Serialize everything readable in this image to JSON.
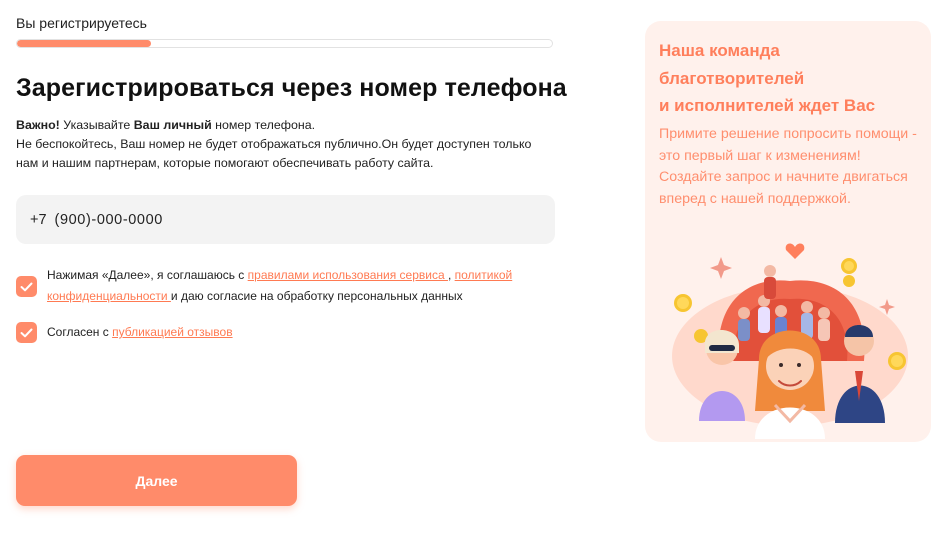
{
  "progress": {
    "label": "Вы регистрируетесь",
    "value_fraction": 0.25
  },
  "title": "Зарегистрироваться через номер телефона",
  "notice": {
    "important": "Важно!",
    "text1": " Указывайте ",
    "bold2": "Ваш личный",
    "text2": " номер телефона.",
    "line2": "Не беспокойтесь, Ваш номер не будет отображаться публично.Он будет доступен только нам и нашим партнерам, которые помогают обеспечивать работу сайта."
  },
  "phone": {
    "code": "+7",
    "value": "",
    "placeholder": "(900)-000-0000"
  },
  "consent1": {
    "checked": true,
    "prefix": "Нажимая «Далее», я соглашаюсь с ",
    "link1": "правилами использования сервиса ",
    "sep": ", ",
    "link2": "политикой конфиденциальности ",
    "suffix": " и даю согласие на обработку персональных данных"
  },
  "consent2": {
    "checked": true,
    "prefix": "Согласен с ",
    "link": "публикацией отзывов"
  },
  "submit_label": "Далее",
  "promo": {
    "title_line1": "Наша команда",
    "title_line2": "благотворителей",
    "title_line3": "и исполнителей ждет Вас",
    "text": "Примите решение попросить помощи - это первый шаг к изменениям! Создайте запрос и начните двигаться вперед с нашей поддержкой."
  },
  "colors": {
    "accent": "#ff8b6a",
    "link": "#ff7a52",
    "promo_bg": "#fff1ec",
    "field_bg": "#f3f3f3"
  }
}
